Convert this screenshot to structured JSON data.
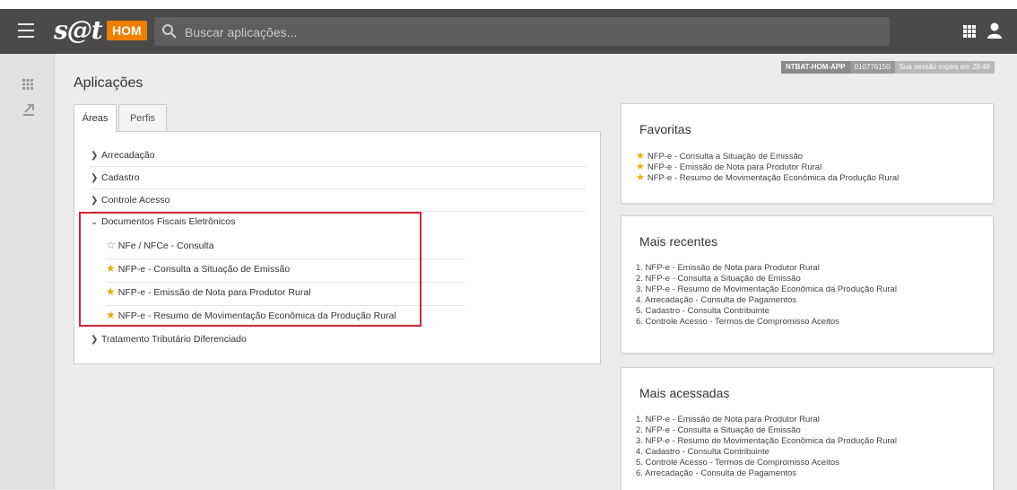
{
  "header": {
    "logo": "s@t",
    "env_badge": "HOM",
    "search_placeholder": "Buscar aplicações..."
  },
  "session": {
    "server": "NTBAT-HOM-APP",
    "user_id": "010776150",
    "expiry": "Sua sessão expira em 29:46"
  },
  "page": {
    "title": "Aplicações"
  },
  "tabs": [
    {
      "label": "Áreas"
    },
    {
      "label": "Perfis"
    }
  ],
  "tree": {
    "items": [
      {
        "label": "Arrecadação"
      },
      {
        "label": "Cadastro"
      },
      {
        "label": "Controle Acesso"
      },
      {
        "label": "Documentos Fiscais Eletrônicos"
      },
      {
        "label": "Tratamento Tributário Diferenciado"
      }
    ],
    "children": [
      {
        "label": "NFe / NFCe - Consulta",
        "favorite": false
      },
      {
        "label": "NFP-e - Consulta a Situação de Emissão",
        "favorite": true
      },
      {
        "label": "NFP-e - Emissão de Nota para Produtor Rural",
        "favorite": true
      },
      {
        "label": "NFP-e - Resumo de Movimentação Econômica da Produção Rural",
        "favorite": true
      }
    ]
  },
  "favoritas": {
    "title": "Favoritas",
    "items": [
      "NFP-e - Consulta a Situação de Emissão",
      "NFP-e - Emissão de Nota para Produtor Rural",
      "NFP-e - Resumo de Movimentação Econômica da Produção Rural"
    ]
  },
  "recentes": {
    "title": "Mais recentes",
    "items": [
      "1. NFP-e - Emissão de Nota para Produtor Rural",
      "2. NFP-e - Consulta a Situação de Emissão",
      "3. NFP-e - Resumo de Movimentação Econômica da Produção Rural",
      "4. Arrecadação - Consulta de Pagamentos",
      "5. Cadastro - Consulta Contribuinte",
      "6. Controle Acesso - Termos de Compromisso Aceitos"
    ]
  },
  "acessadas": {
    "title": "Mais acessadas",
    "items": [
      "1. NFP-e - Emissão de Nota para Produtor Rural",
      "2. NFP-e - Consulta a Situação de Emissão",
      "3. NFP-e - Resumo de Movimentação Econômica da Produção Rural",
      "4. Cadastro - Consulta Contribuinte",
      "5. Controle Acesso - Termos de Compromisso Aceitos",
      "6. Arrecadação - Consulta de Pagamentos"
    ]
  },
  "colors": {
    "topbar": "#4a4a4a",
    "badge": "#f07f00",
    "star": "#e8b000",
    "highlight": "#d6263a"
  },
  "icons": [
    "menu-icon",
    "search-icon",
    "apps-grid-icon",
    "user-icon",
    "export-icon",
    "chevron-right-icon",
    "chevron-down-icon",
    "star-icon"
  ]
}
